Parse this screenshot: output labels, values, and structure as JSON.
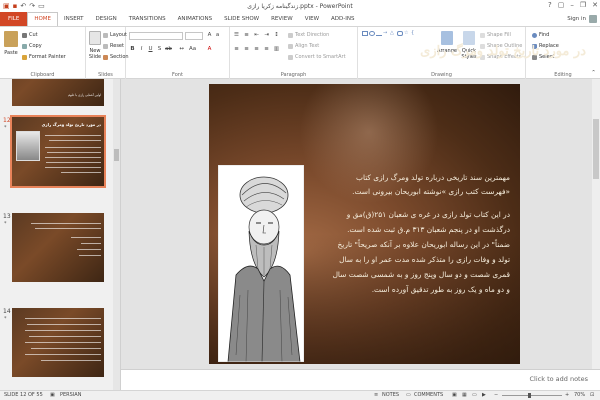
{
  "title_bar": {
    "title": "زندگینامه زکریا رازی.pptx - PowerPoint"
  },
  "tabs": [
    "FILE",
    "HOME",
    "INSERT",
    "DESIGN",
    "TRANSITIONS",
    "ANIMATIONS",
    "SLIDE SHOW",
    "REVIEW",
    "VIEW",
    "ADD-INS"
  ],
  "active_tab": "HOME",
  "account": {
    "sign_in": "Sign in"
  },
  "ribbon": {
    "clipboard": {
      "label": "Clipboard",
      "paste": "Paste",
      "cut": "Cut",
      "copy": "Copy",
      "format_painter": "Format Painter"
    },
    "slides": {
      "label": "Slides",
      "new_slide": "New Slide",
      "layout": "Layout",
      "reset": "Reset",
      "section": "Section"
    },
    "font": {
      "label": "Font"
    },
    "paragraph": {
      "label": "Paragraph",
      "text_direction": "Text Direction",
      "align_text": "Align Text",
      "convert_smartart": "Convert to SmartArt"
    },
    "drawing": {
      "label": "Drawing",
      "arrange": "Arrange",
      "quick_styles": "Quick Styles",
      "shape_fill": "Shape Fill",
      "shape_outline": "Shape Outline",
      "shape_effects": "Shape Effects"
    },
    "editing": {
      "label": "Editing",
      "find": "Find",
      "replace": "Replace",
      "select": "Select"
    }
  },
  "thumbnails": [
    {
      "number": "12",
      "star": "*",
      "title": "در مورد تاریخ تولد ومرگ رازی"
    },
    {
      "number": "13",
      "star": "*",
      "title": ""
    },
    {
      "number": "14",
      "star": "*",
      "title": ""
    }
  ],
  "thumb_top_text": "اولین آشنایی رازی با علوم",
  "slide": {
    "title": "در مورد تاریخ تولد ومرگ رازی",
    "lines": [
      "مهمترین سند تاریخی درباره تولد ومرگ رازی کتاب",
      "«فهرست کتب رازی »نوشته ابوریحان بیرونی است.",
      "در این کتاب تولد رازی در غره ی شعبان ۲۵۱(ق)مق و",
      "درگذشت او در پنجم شعبان ۳۱۳ م.ق ثبت شده است.",
      "ضمناً\" در این رساله ابوریحان علاوه بر آنکه صریحاً\" تاریخ",
      "تولد و وفات رازی را متذکر شده مدت عمر او را به سال",
      "قمری شصت و دو سال وپنج روز و به شمسی شصت سال",
      "و دو ماه و یک روز به طور تدقیق آورده است."
    ]
  },
  "notes": "Click to add notes",
  "status": {
    "slide_indicator": "SLIDE 12 OF 55",
    "language": "PERSIAN",
    "notes_btn": "NOTES",
    "comments_btn": "COMMENTS",
    "zoom": "70%"
  },
  "colors": {
    "accent": "#D24726",
    "slide_text": "#F6EEDD"
  }
}
